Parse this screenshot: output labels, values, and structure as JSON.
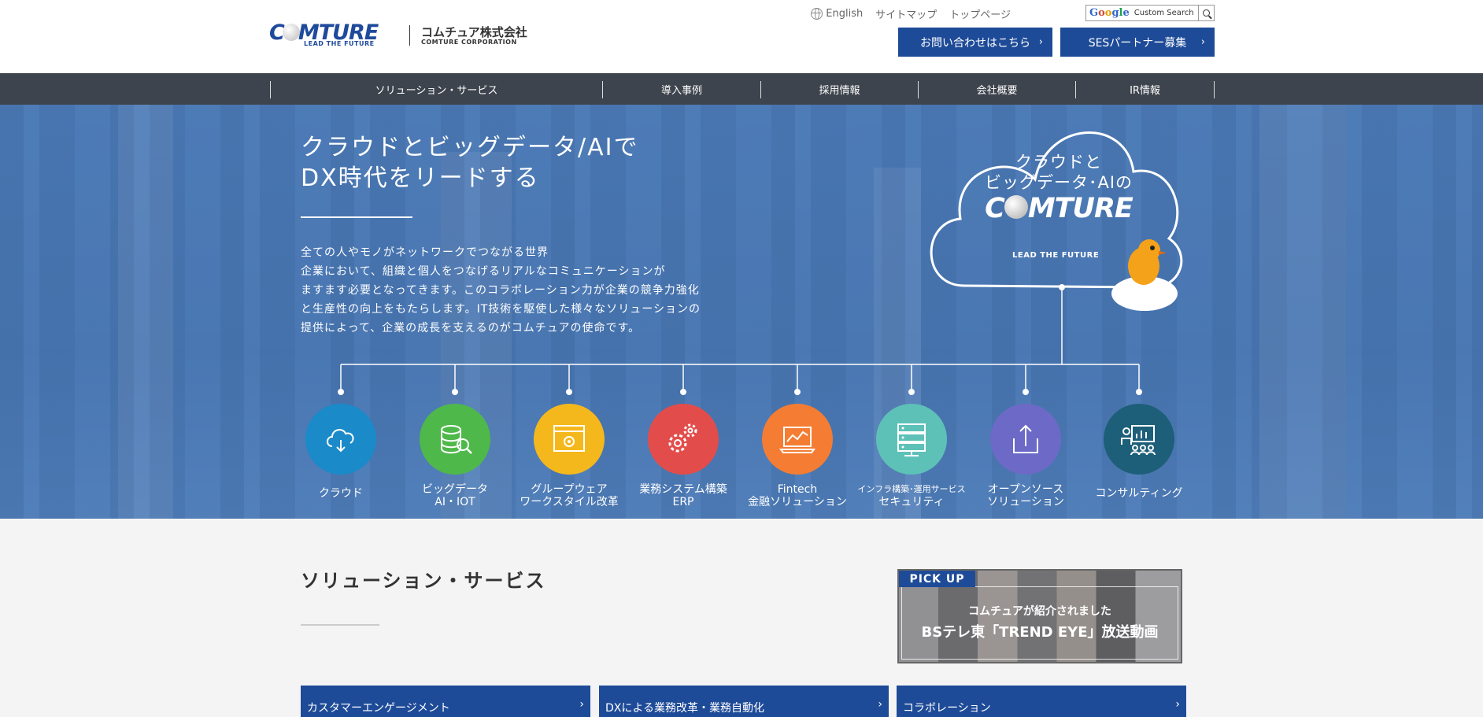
{
  "header": {
    "logo_mark": "COMTURE",
    "logo_tagline": "LEAD THE FUTURE",
    "logo_jp": "コムチュア株式会社",
    "logo_en": "COMTURE CORPORATION",
    "utility": {
      "english": "English",
      "sitemap": "サイトマップ",
      "top": "トップページ"
    },
    "search": {
      "brand": "Google",
      "placeholder": "Custom Search"
    },
    "cta_contact": "お問い合わせはこちら",
    "cta_ses": "SESパートナー募集"
  },
  "nav": {
    "items": [
      "ソリューション・サービス",
      "導入事例",
      "採用情報",
      "会社概要",
      "IR情報"
    ]
  },
  "hero": {
    "title_line1": "クラウドとビッグデータ/AIで",
    "title_line2": "DX時代をリードする",
    "desc": [
      "全ての人やモノがネットワークでつながる世界",
      "企業において、組織と個人をつなげるリアルなコミュニケーションが",
      "ますます必要となってきます。このコラボレーション力が企業の競争力強化",
      "と生産性の向上をもたらします。IT技術を駆使した様々なソリューションの",
      "提供によって、企業の成長を支えるのがコムチュアの使命です。"
    ],
    "cloud_line1": "クラウドと",
    "cloud_line2": "ビッグデータ･AIの",
    "cloud_logo": "COMTURE",
    "cloud_tagline": "LEAD THE FUTURE"
  },
  "services": [
    {
      "line1": "クラウド",
      "line2": "",
      "color": "#1a8ac9",
      "icon": "cloud-icon"
    },
    {
      "line1": "ビッグデータ",
      "line2": "AI・IOT",
      "color": "#4fb84a",
      "icon": "database-icon"
    },
    {
      "line1": "グループウェア",
      "line2": "ワークスタイル改革",
      "color": "#f5b81c",
      "icon": "groupware-icon"
    },
    {
      "line1": "業務システム構築",
      "line2": "ERP",
      "color": "#e24d4b",
      "icon": "gears-icon"
    },
    {
      "line1": "Fintech",
      "line2": "金融ソリューション",
      "color": "#f47d33",
      "icon": "chart-laptop-icon"
    },
    {
      "line1": "インフラ構築･運用サービス",
      "line2": "セキュリティ",
      "color": "#5ec1b8",
      "icon": "server-icon"
    },
    {
      "line1": "オープンソース",
      "line2": "ソリューション",
      "color": "#6c69c7",
      "icon": "upload-icon"
    },
    {
      "line1": "コンサルティング",
      "line2": "",
      "color": "#1d5f79",
      "icon": "consulting-icon"
    }
  ],
  "section": {
    "title": "ソリューション・サービス",
    "pickup_badge": "PICK UP",
    "pickup_line1": "コムチュアが紹介されました",
    "pickup_line2": "BSテレ東「TREND EYE」放送動画",
    "cards": [
      "カスタマーエンゲージメント",
      "DXによる業務改革・業務自動化",
      "コラボレーション"
    ]
  },
  "colors": {
    "brand": "#1e4b98",
    "nav_bg": "#3e444d"
  }
}
